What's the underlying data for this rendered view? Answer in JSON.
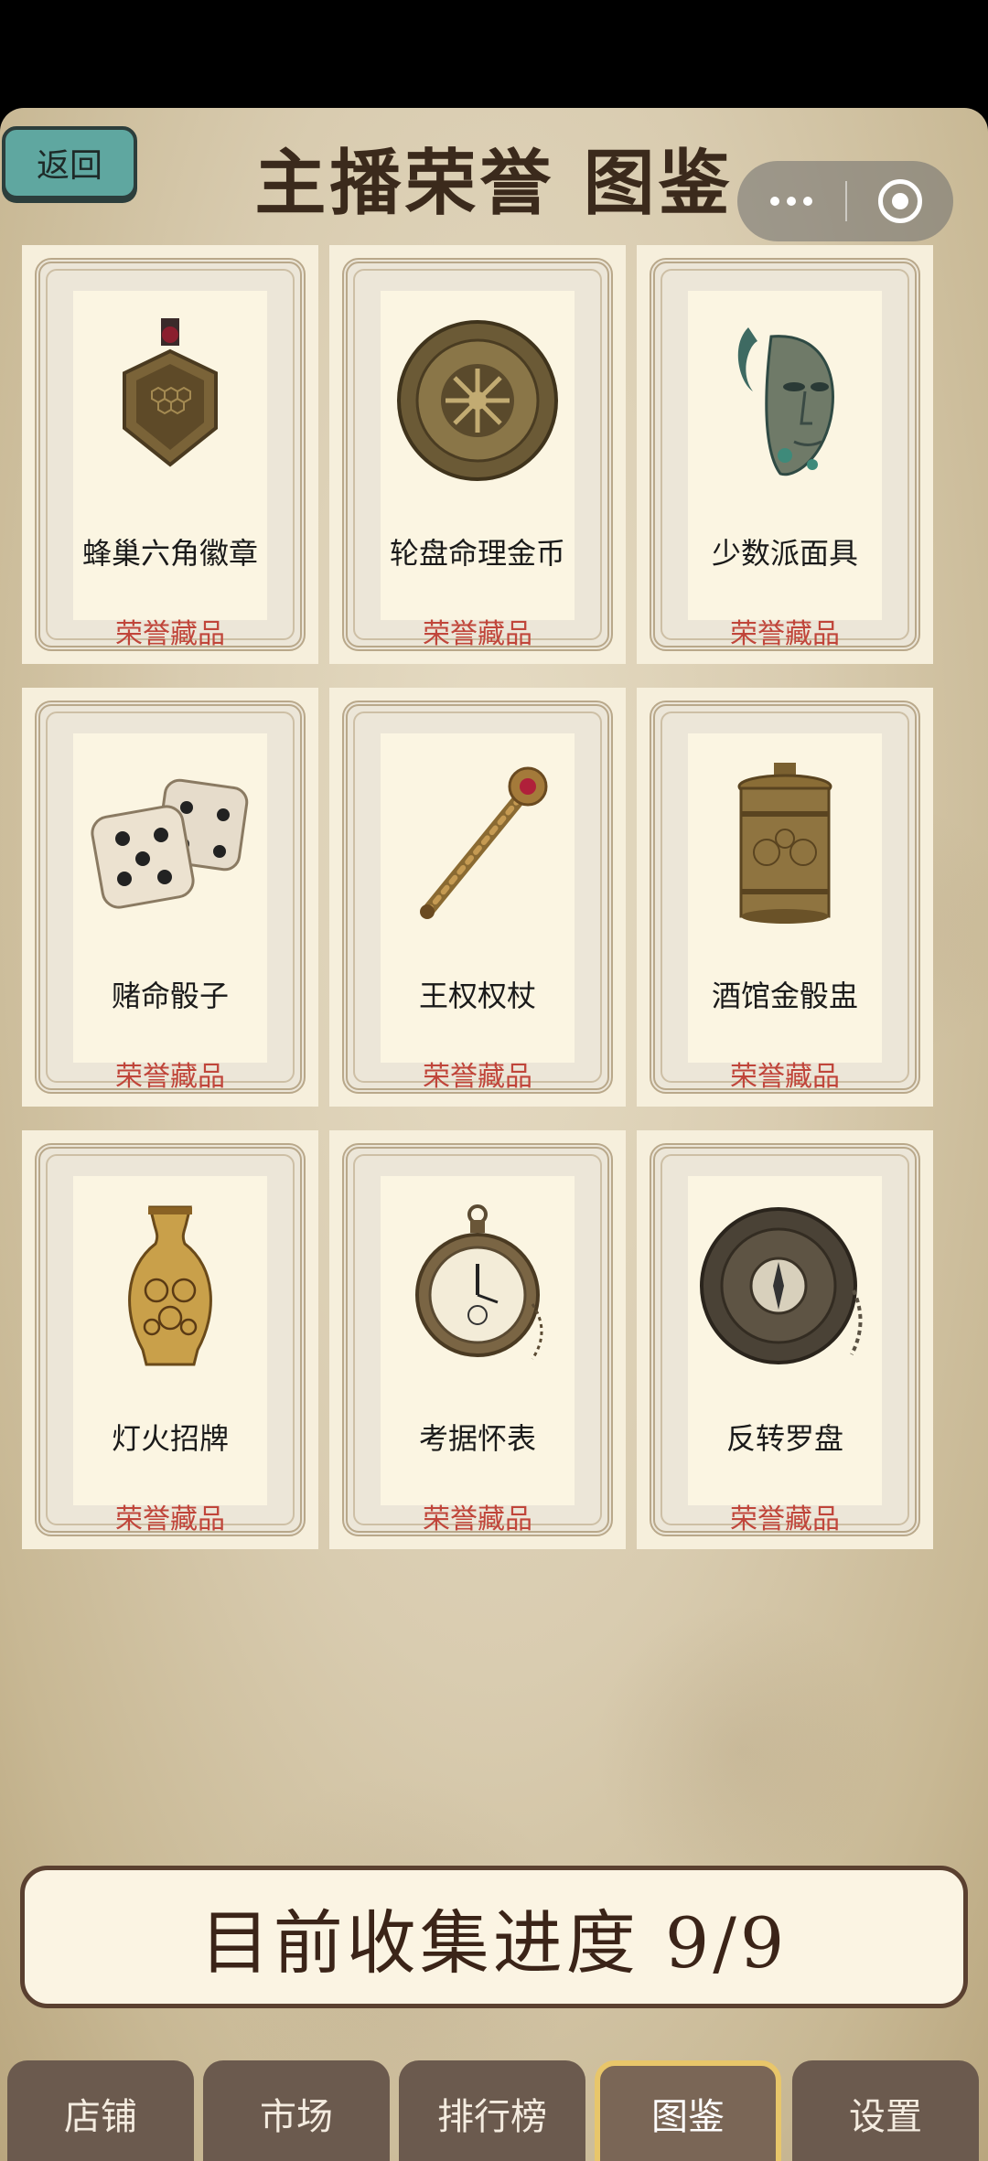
{
  "header": {
    "back_label": "返回",
    "title": "主播荣誉 图鉴"
  },
  "cards": [
    {
      "name": "蜂巢六角徽章",
      "tag": "荣誉藏品",
      "icon": "hexagon-medal-icon"
    },
    {
      "name": "轮盘命理金币",
      "tag": "荣誉藏品",
      "icon": "roulette-coin-icon"
    },
    {
      "name": "少数派面具",
      "tag": "荣誉藏品",
      "icon": "bronze-mask-icon"
    },
    {
      "name": "赌命骰子",
      "tag": "荣誉藏品",
      "icon": "dice-icon"
    },
    {
      "name": "王权权杖",
      "tag": "荣誉藏品",
      "icon": "scepter-icon"
    },
    {
      "name": "酒馆金骰盅",
      "tag": "荣誉藏品",
      "icon": "dice-cup-icon"
    },
    {
      "name": "灯火招牌",
      "tag": "荣誉藏品",
      "icon": "vase-icon"
    },
    {
      "name": "考据怀表",
      "tag": "荣誉藏品",
      "icon": "pocket-watch-icon"
    },
    {
      "name": "反转罗盘",
      "tag": "荣誉藏品",
      "icon": "compass-icon"
    }
  ],
  "progress": {
    "label": "目前收集进度 9/9",
    "collected": 9,
    "total": 9
  },
  "tabs": [
    {
      "label": "店铺",
      "active": false
    },
    {
      "label": "市场",
      "active": false
    },
    {
      "label": "排行榜",
      "active": false
    },
    {
      "label": "图鉴",
      "active": true
    },
    {
      "label": "设置",
      "active": false
    }
  ],
  "colors": {
    "accent_teal": "#5fa7a0",
    "tag_red": "#c0453a",
    "tab_active_border": "#e8c66a"
  }
}
